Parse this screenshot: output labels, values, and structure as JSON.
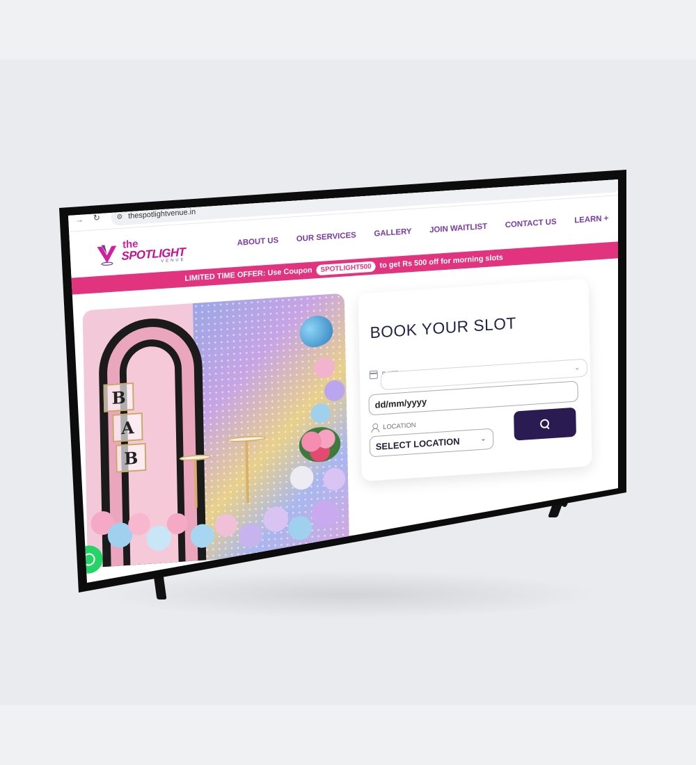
{
  "browser": {
    "url": "thespotlightvenue.in"
  },
  "site": {
    "logo": {
      "the": "the",
      "name": "SPOTLIGHT",
      "sub": "VENUE"
    },
    "nav": [
      {
        "label": "ABOUT US"
      },
      {
        "label": "OUR SERVICES"
      },
      {
        "label": "GALLERY"
      },
      {
        "label": "JOIN WAITLIST"
      },
      {
        "label": "CONTACT US"
      },
      {
        "label": "LEARN +"
      }
    ],
    "offer": {
      "prefix": "LIMITED TIME OFFER: Use Coupon",
      "coupon": "SPOTLIGHT500",
      "suffix": "to get Rs 500 off for morning slots"
    },
    "hero": {
      "boxes": [
        "B",
        "A",
        "B"
      ]
    }
  },
  "booking": {
    "title": "BOOK YOUR SLOT",
    "date_label": "DATE",
    "date_value": "dd/mm/yyyy",
    "location_label": "LOCATION",
    "location_value": "SELECT LOCATION"
  },
  "colors": {
    "brand_pink": "#e2337e",
    "brand_purple": "#7a3aa6",
    "button_dark": "#2a1c52",
    "whatsapp": "#25d366"
  }
}
